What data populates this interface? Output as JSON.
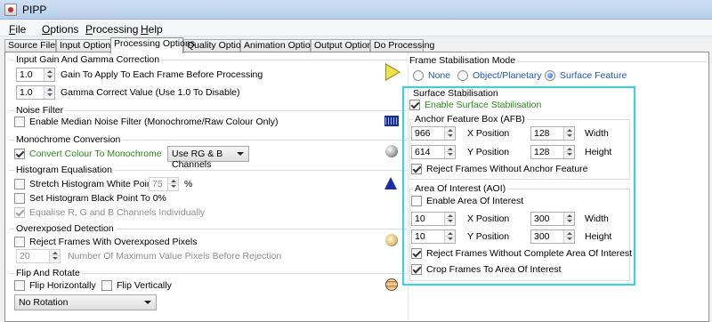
{
  "window": {
    "title": "PIPP"
  },
  "menu": [
    {
      "accel": "F",
      "rest": "ile"
    },
    {
      "accel": "O",
      "rest": "ptions"
    },
    {
      "accel": "P",
      "rest": "rocessing"
    },
    {
      "accel": "H",
      "rest": "elp"
    }
  ],
  "tabs": [
    "Source Files",
    "Input Options",
    "Processing Options",
    "Quality Options",
    "Animation Options",
    "Output Options",
    "Do Processing"
  ],
  "active_tab": "Processing Options",
  "input_gain": {
    "title": "Input Gain And Gamma Correction",
    "gain_value": "1.0",
    "gain_label": "Gain To Apply To Each Frame Before Processing",
    "gamma_value": "1.0",
    "gamma_label": "Gamma Correct Value (Use 1.0 To Disable)"
  },
  "noise_filter": {
    "title": "Noise Filter",
    "median_label": "Enable Median Noise Filter (Monochrome/Raw Colour Only)",
    "median_checked": false
  },
  "mono": {
    "title": "Monochrome Conversion",
    "convert_label": "Convert Colour To Monochrome",
    "convert_checked": true,
    "channels_selected": "Use RG & B Channels"
  },
  "histogram": {
    "title": "Histogram Equalisation",
    "stretch_label": "Stretch Histogram White Point To:",
    "stretch_value": "75",
    "stretch_unit": "%",
    "black_label": "Set Histogram Black Point To 0%",
    "equalise_label": "Equalise R, G and B Channels Individually"
  },
  "overexposed": {
    "title": "Overexposed Detection",
    "reject_label": "Reject Frames With Overexposed Pixels",
    "count_value": "20",
    "count_label": "Number Of Maximum Value Pixels Before Rejection"
  },
  "flip": {
    "title": "Flip And Rotate",
    "flip_h_label": "Flip Horizontally",
    "flip_v_label": "Flip Vertically",
    "rotation_selected": "No Rotation"
  },
  "stabilisation_mode": {
    "title": "Frame Stabilisation Mode",
    "options": [
      "None",
      "Object/Planetary",
      "Surface Feature"
    ],
    "selected": "Surface Feature"
  },
  "surface": {
    "title": "Surface Stabilisation",
    "enable_label": "Enable Surface Stabilisation",
    "enable_checked": true,
    "afb": {
      "title": "Anchor Feature Box (AFB)",
      "x_value": "966",
      "x_label": "X Position",
      "y_value": "614",
      "y_label": "Y Position",
      "width_value": "128",
      "width_label": "Width",
      "height_value": "128",
      "height_label": "Height",
      "reject_label": "Reject Frames Without Anchor Feature",
      "reject_checked": true
    },
    "aoi": {
      "title": "Area Of Interest (AOI)",
      "enable_label": "Enable Area Of Interest",
      "enable_checked": false,
      "x_value": "10",
      "x_label": "X Position",
      "y_value": "10",
      "y_label": "Y Position",
      "width_value": "300",
      "width_label": "Width",
      "height_value": "300",
      "height_label": "Height",
      "reject_label": "Reject Frames Without Complete Area Of Interest",
      "reject_checked": true,
      "crop_label": "Crop Frames To Area Of Interest",
      "crop_checked": true
    }
  },
  "colors": {
    "highlight": "#2ed6e6",
    "checked_text": "#2c8a17",
    "radio_text": "#2354b6"
  }
}
